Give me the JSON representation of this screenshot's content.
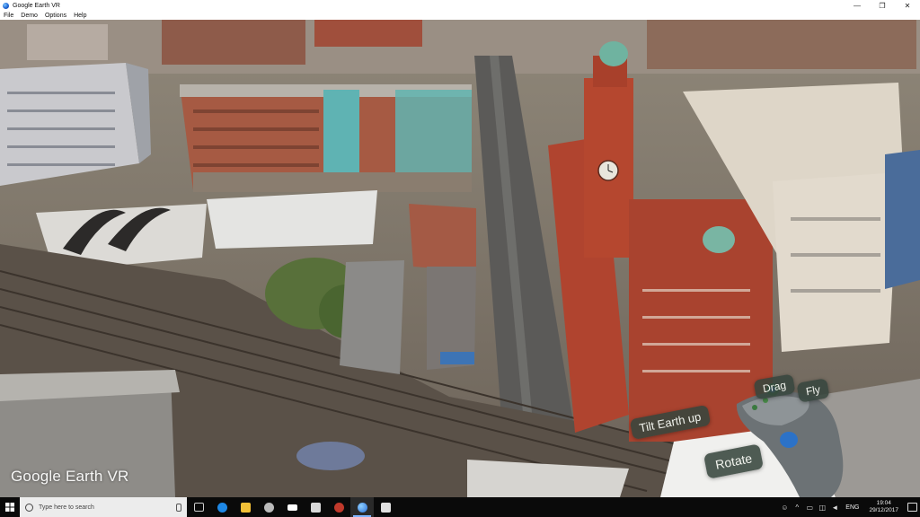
{
  "window": {
    "title": "Google Earth VR",
    "minimize": "—",
    "maximize": "❐",
    "close": "✕"
  },
  "menu": [
    "File",
    "Demo",
    "Options",
    "Help"
  ],
  "watermark": "Google Earth VR",
  "controller": {
    "tilt_label": "Tilt Earth up",
    "rotate_label": "Rotate",
    "drag_label": "Drag",
    "fly_label": "Fly"
  },
  "taskbar": {
    "search_placeholder": "Type here to search",
    "apps": [
      {
        "name": "task-view",
        "color": "#cfcfcf"
      },
      {
        "name": "edge",
        "color": "#1e88e5"
      },
      {
        "name": "file-explorer",
        "color": "#f2c037"
      },
      {
        "name": "app-4",
        "color": "#bbbbbb"
      },
      {
        "name": "app-5",
        "color": "#ffffff"
      },
      {
        "name": "app-6",
        "color": "#d9d9d9"
      },
      {
        "name": "app-7",
        "color": "#c0392b"
      },
      {
        "name": "google-earth-vr",
        "color": "#3b82f6"
      },
      {
        "name": "photos",
        "color": "#e0e0e0"
      }
    ],
    "language": "ENG",
    "time": "19:04",
    "date": "29/12/2017"
  },
  "colors": {
    "label_bg": "#374a3f",
    "taskbar_bg": "#0a0a0a",
    "search_bg": "#ececec"
  }
}
